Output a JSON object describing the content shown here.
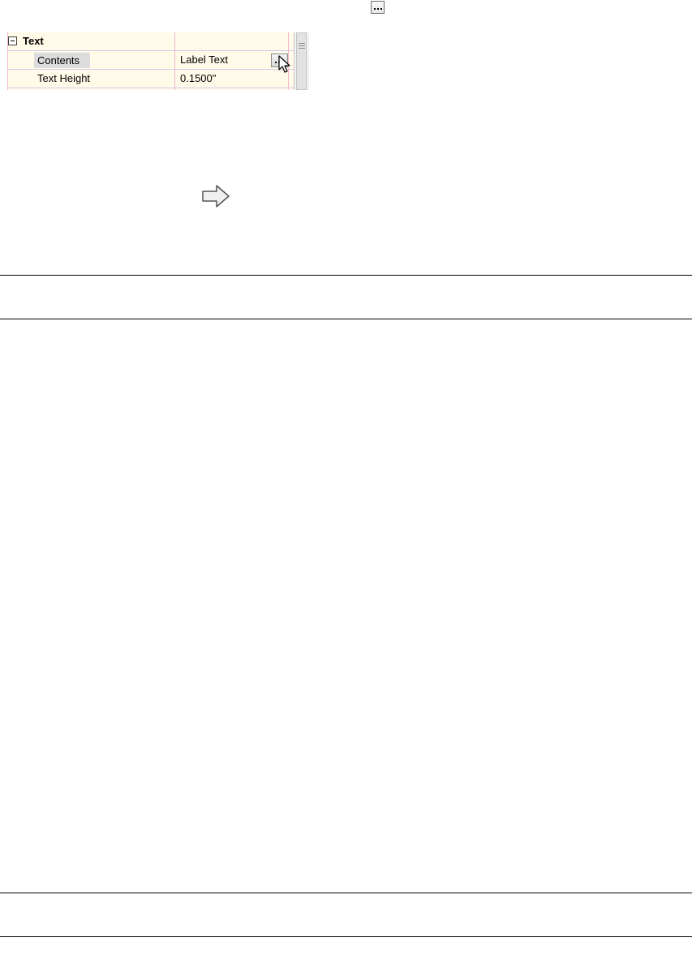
{
  "toolbar": {
    "ellipsis_icon": "ellipsis-button-icon"
  },
  "property_grid": {
    "category": {
      "label": "Text",
      "expander_icon": "collapse-minus-icon"
    },
    "rows": [
      {
        "name": "Contents",
        "value": "Label Text",
        "has_ellipsis_button": true
      },
      {
        "name": "Text Height",
        "value": "0.1500\""
      }
    ],
    "colors": {
      "background": "#fffbe8",
      "grid_lines": "#f4b5cf",
      "row_separators": "#d6c7e9",
      "selected_name_bg": "#dcdcdc"
    }
  },
  "indicators": {
    "next_step_icon": "right-arrow-icon",
    "cursor_icon": "mouse-pointer-icon"
  }
}
